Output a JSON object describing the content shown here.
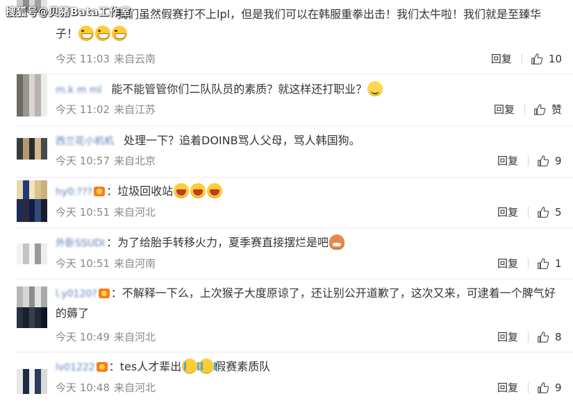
{
  "watermark": "搜狐号@贝猪Bata工作室",
  "ui": {
    "reply_label": "回复",
    "today": "今天",
    "from_prefix": "来自"
  },
  "comments": [
    {
      "user": "",
      "text_parts": [
        "我们虽然假赛打不上lpl，但是我们可以在韩服重拳出击！我们太牛啦！我们就是至臻华子！"
      ],
      "emojis": [
        "grin",
        "grin",
        "grin"
      ],
      "time": "今天 11:03",
      "location": "来自云南",
      "likes": "10"
    },
    {
      "user": "m.k m ml",
      "text_parts": [
        "能不能管管你们二队队员的素质？就这样还打职业？"
      ],
      "emojis": [
        "smile"
      ],
      "time": "今天 11:02",
      "location": "来自江苏",
      "likes": "赞"
    },
    {
      "user": "西兰花小机机",
      "text_parts": [
        "处理一下？追着DOINB骂人父母，骂人韩国狗。"
      ],
      "emojis": [],
      "time": "今天 10:57",
      "location": "来自北京",
      "likes": "9"
    },
    {
      "user": "hy0:???",
      "text_parts": [
        "垃圾回收站"
      ],
      "emojis": [
        "laugh",
        "laugh",
        "laugh"
      ],
      "time": "今天 10:51",
      "location": "来自河北",
      "likes": "5"
    },
    {
      "user": "外卧SSUDI",
      "text_parts": [
        "为了给胎手转移火力，夏季赛直接摆烂是吧"
      ],
      "emojis": [
        "sad"
      ],
      "time": "今天 10:51",
      "location": "来自河南",
      "likes": "1"
    },
    {
      "user": "l.y0120?",
      "text_parts": [
        "不解释一下么，上次猴子大度原谅了，还让别公开道歉了，这次又来，可逮着一个脾气好的薅了"
      ],
      "emojis": [],
      "time": "今天 10:49",
      "location": "来自河北",
      "likes": "8"
    },
    {
      "user": "lv01222",
      "text_parts": [
        "tes人才辈出",
        "假赛素质队"
      ],
      "emojis": [
        "cry",
        "cry"
      ],
      "time": "今天 10:48",
      "location": "来自河北",
      "likes": "9"
    }
  ],
  "colors": {
    "username": "#5b7bb8",
    "meta": "#888888",
    "text": "#333333",
    "divider": "#ececec"
  }
}
